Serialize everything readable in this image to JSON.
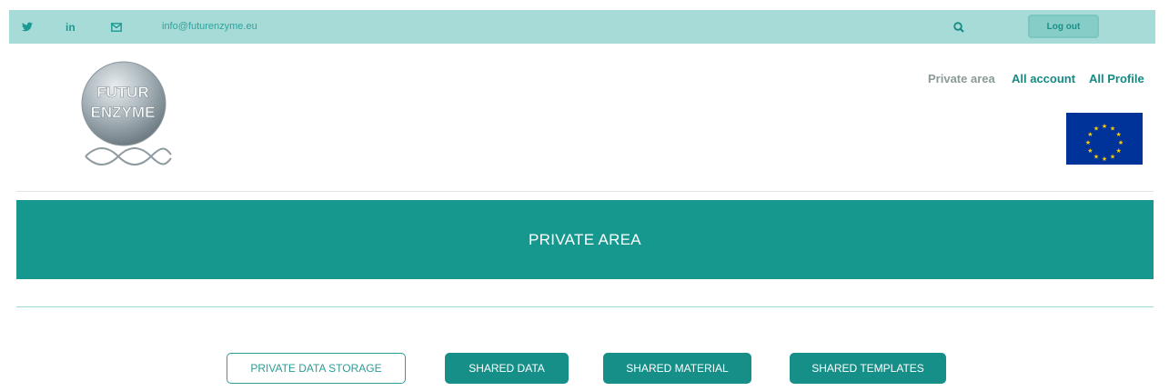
{
  "topbar": {
    "twitter_icon": "twitter-icon",
    "linkedin_label": "in",
    "mail_icon": "mail-icon",
    "email": "info@futurenzyme.eu",
    "search_icon": "search-icon",
    "logout_label": "Log out"
  },
  "nav": {
    "private_area": "Private area",
    "all_account": "All account",
    "all_profile": "All Profile"
  },
  "logo": {
    "line1": "FUTUR",
    "line2": "ENZYME"
  },
  "banner": {
    "title": "PRIVATE AREA"
  },
  "buttons": {
    "private_data_storage": "PRIVATE DATA STORAGE",
    "shared_data": "SHARED DATA",
    "shared_material": "SHARED MATERIAL",
    "shared_templates": "SHARED TEMPLATES"
  },
  "colors": {
    "topbar": "#a7dbd8",
    "accent": "#17988f",
    "eu_blue": "#003399",
    "eu_star": "#ffcc00"
  }
}
